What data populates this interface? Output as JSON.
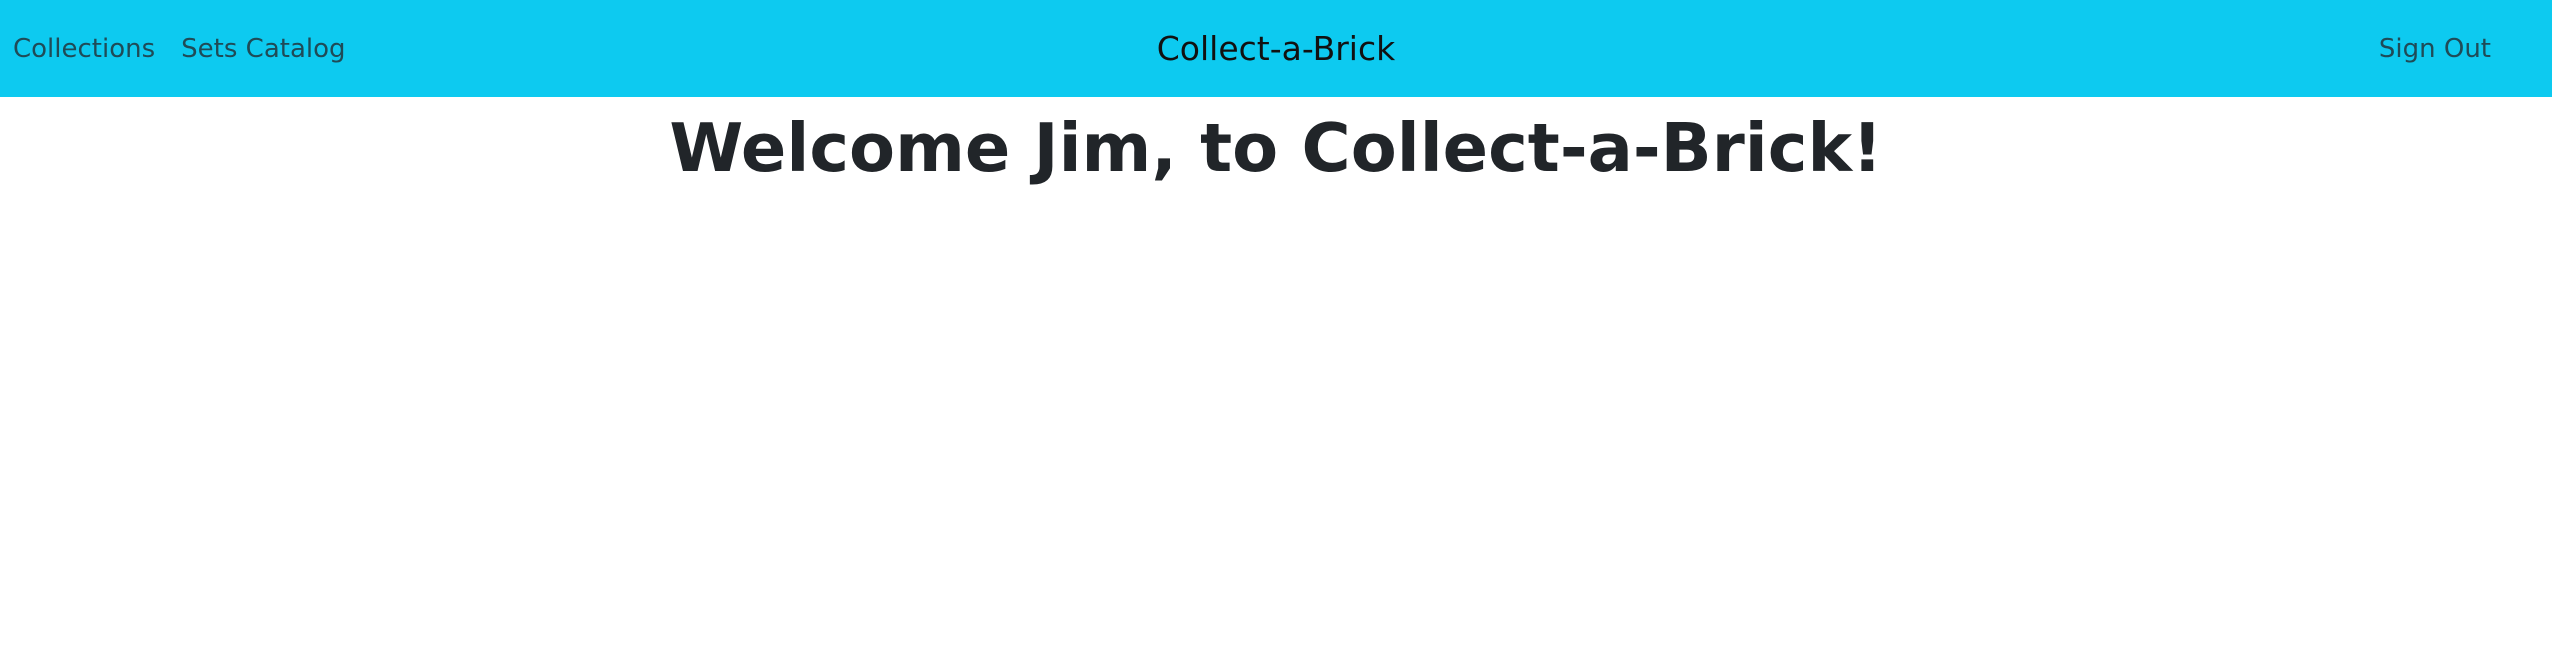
{
  "navbar": {
    "links": [
      {
        "label": "Collections"
      },
      {
        "label": "Sets Catalog"
      }
    ],
    "brand": "Collect-a-Brick",
    "sign_out_label": "Sign Out",
    "background_color": "#0dcaf0"
  },
  "main": {
    "heading": "Welcome Jim, to Collect-a-Brick!"
  }
}
